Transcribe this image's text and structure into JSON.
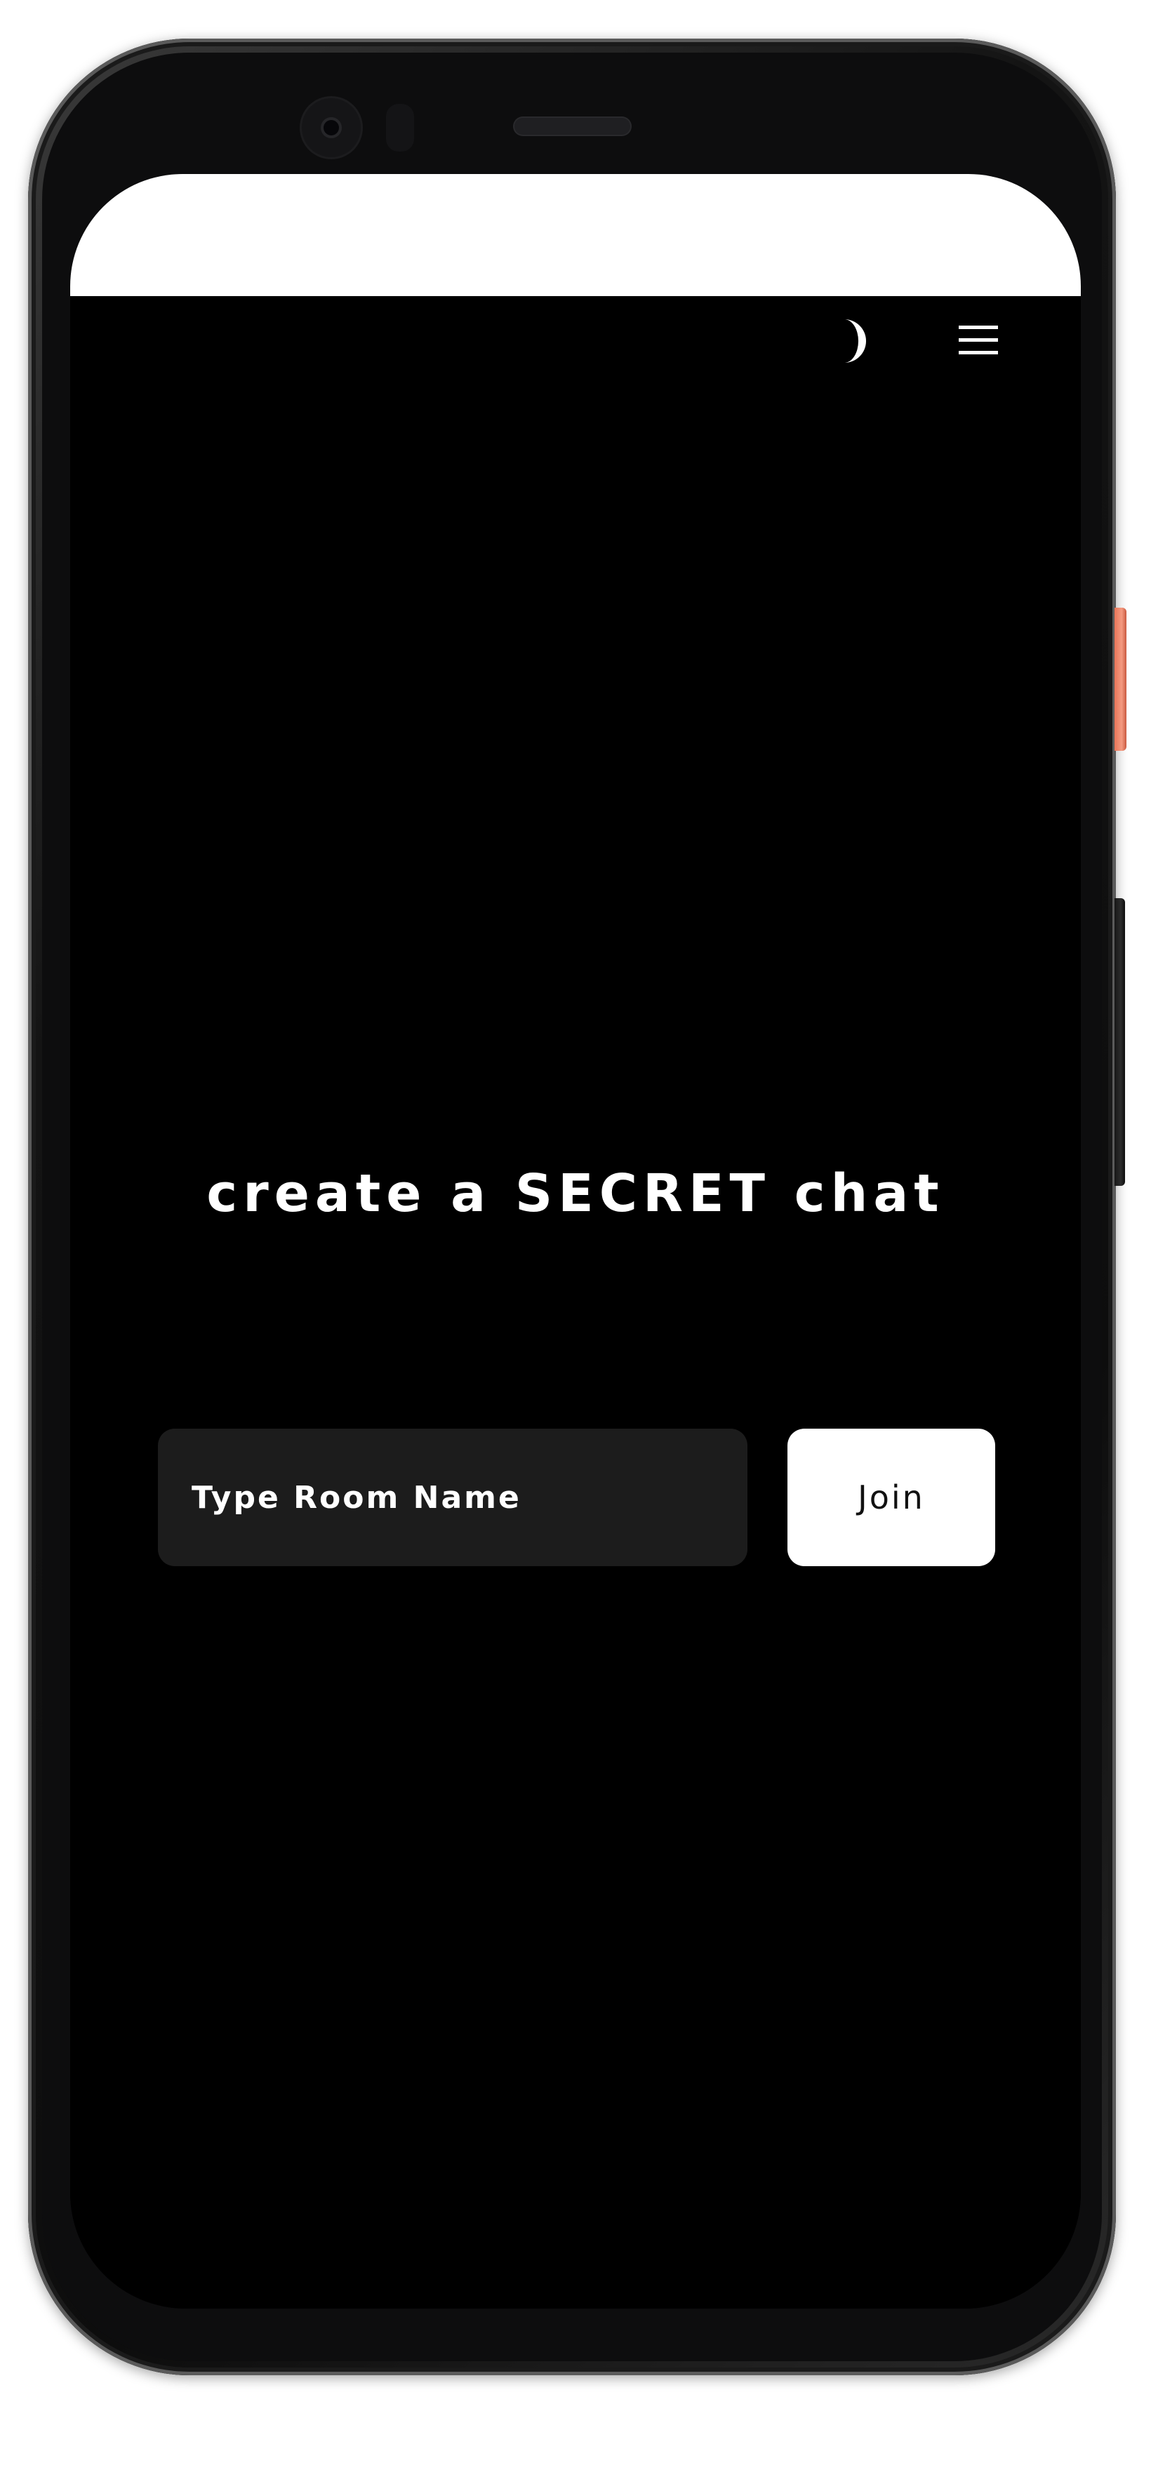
{
  "header": {
    "theme_toggle_icon": "crescent-moon-icon",
    "menu_icon": "hamburger-menu-icon"
  },
  "main": {
    "headline": "create a SECRET chat",
    "room_input": {
      "placeholder": "Type Room Name",
      "value": ""
    },
    "join_label": "Join"
  },
  "colors": {
    "background": "#000000",
    "input_background": "#1c1c1c",
    "button_background": "#ffffff",
    "text": "#ffffff",
    "device_accent_button": "#f08a6e"
  }
}
